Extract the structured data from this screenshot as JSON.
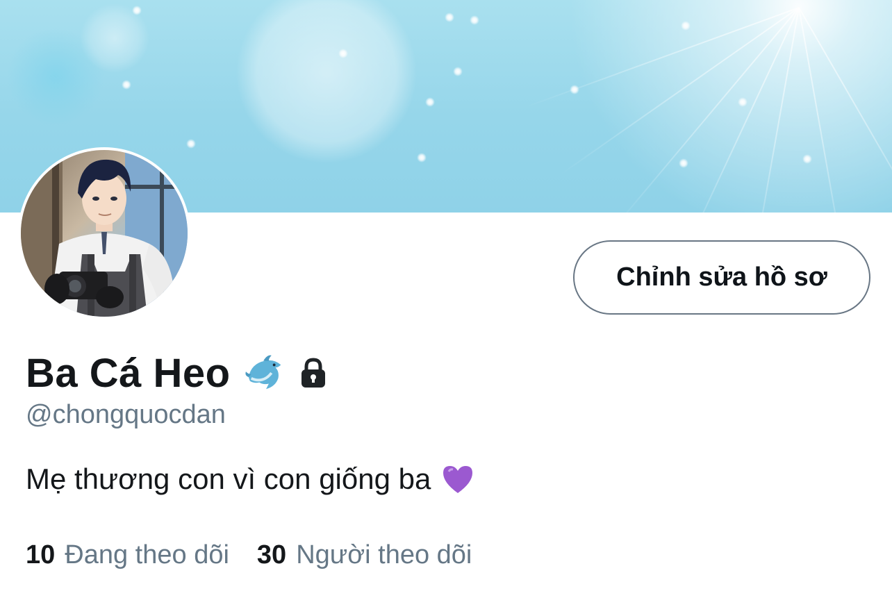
{
  "profile": {
    "display_name": "Ba Cá Heo",
    "handle": "@chongquocdan",
    "bio": "Mẹ thương con vì con giống ba",
    "name_icons": [
      "dolphin-icon",
      "lock-icon"
    ],
    "bio_icon": "purple-heart-icon"
  },
  "actions": {
    "edit_profile_label": "Chỉnh sửa hồ sơ"
  },
  "stats": {
    "following_count": "10",
    "following_label": "Đang theo dõi",
    "followers_count": "30",
    "followers_label": "Người theo dõi"
  },
  "colors": {
    "banner": "#96d6ea",
    "secondary_text": "#657786",
    "primary_text": "#14171a",
    "button_border": "#687684",
    "heart": "#9b59d0"
  }
}
